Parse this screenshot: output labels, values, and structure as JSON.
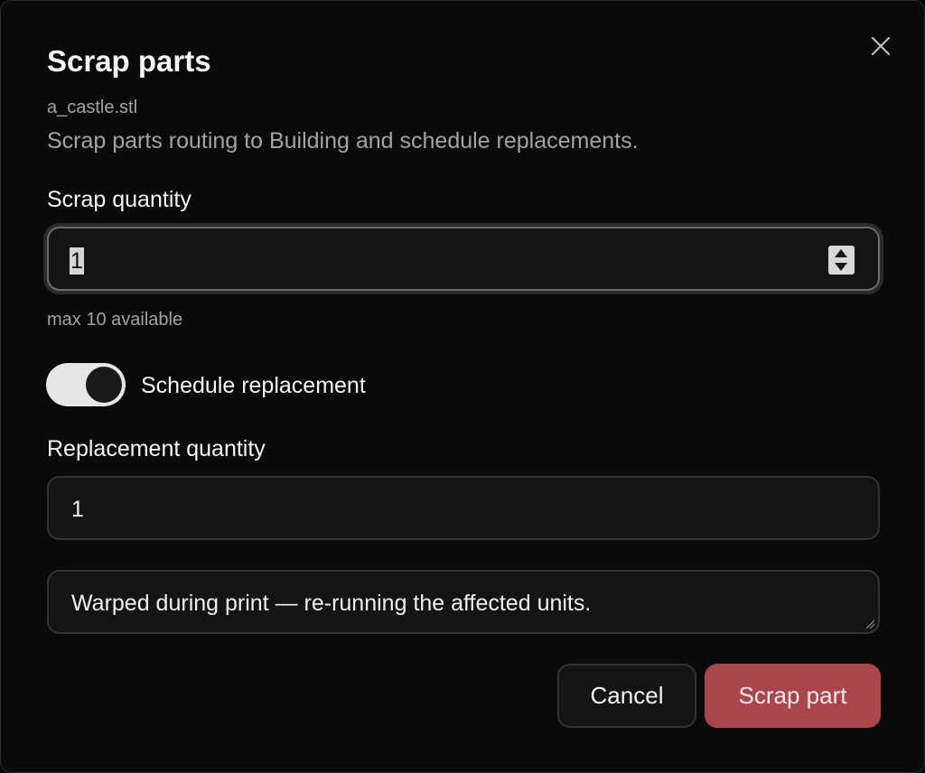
{
  "dialog": {
    "title": "Scrap parts",
    "filename": "a_castle.stl",
    "description": "Scrap parts routing to Building and schedule replacements.",
    "close_icon": "close-icon"
  },
  "scrap_quantity": {
    "label": "Scrap quantity",
    "value": "1",
    "hint": "max 10 available"
  },
  "schedule_replacement": {
    "label": "Schedule replacement",
    "enabled": true
  },
  "replacement_quantity": {
    "label": "Replacement quantity",
    "value": "1"
  },
  "reason": {
    "value": "Warped during print — re-running the affected units."
  },
  "actions": {
    "cancel_label": "Cancel",
    "scrap_label": "Scrap part"
  },
  "colors": {
    "background": "#0a0a0a",
    "field": "#141414",
    "accent_destructive": "#a8464b",
    "muted_text": "#a3a3a3"
  }
}
